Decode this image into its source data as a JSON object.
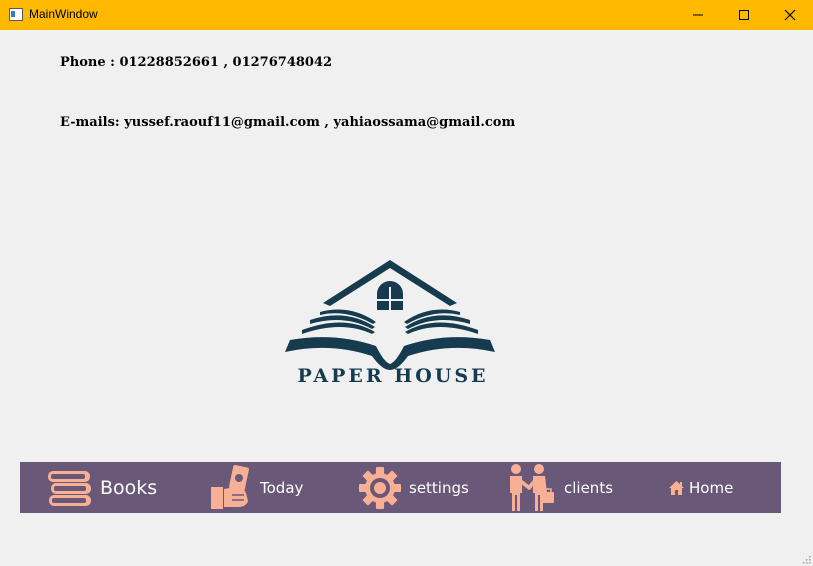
{
  "window": {
    "title": "MainWindow",
    "controls": [
      "minimize-icon",
      "maximize-icon",
      "close-icon"
    ],
    "titlebar_color": "#ffb900"
  },
  "contact": {
    "phone": "Phone : 01228852661 , 01276748042",
    "emails": "E-mails: yussef.raouf11@gmail.com , yahiaossama@gmail.com"
  },
  "logo": {
    "text": "PAPER HOUSE",
    "color": "#163b4e"
  },
  "nav": {
    "background": "#6a5878",
    "icon_color": "#f8b095",
    "items": [
      {
        "label": "Books",
        "icon": "books-icon"
      },
      {
        "label": "Today",
        "icon": "money-hand-icon"
      },
      {
        "label": "settings",
        "icon": "gear-icon"
      },
      {
        "label": "clients",
        "icon": "handshake-icon"
      },
      {
        "label": "Home",
        "icon": "home-icon"
      }
    ]
  }
}
